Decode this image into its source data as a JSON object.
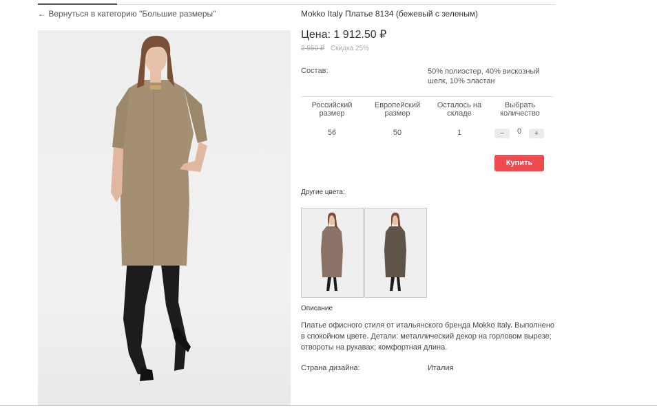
{
  "nav": {
    "back_link": "Вернуться в категорию \"Большие размеры\""
  },
  "product": {
    "title": "Mokko Italy Платье 8134 (бежевый с зеленым)",
    "price": "Цена: 1 912.50 ₽",
    "old_price": "2 550 ₽",
    "discount": "Скидка 25%",
    "composition_label": "Состав:",
    "composition_value": "50% полиэстер, 40% вискозный шелк, 10% эластан"
  },
  "size_table": {
    "headers": [
      "Российский размер",
      "Европейский размер",
      "Осталось на складе",
      "Выбрать количество"
    ],
    "rows": [
      {
        "ru_size": "56",
        "eu_size": "50",
        "in_stock": "1",
        "quantity": "0"
      }
    ],
    "minus_label": "−",
    "plus_label": "+"
  },
  "buy_button": {
    "label": "Купить"
  },
  "other_colors": {
    "label": "Другие цвета:",
    "items": [
      {
        "color": "#8a7366"
      },
      {
        "color": "#5f5449"
      }
    ]
  },
  "description": {
    "label": "Описание",
    "text": "Платье офисного стиля от итальянского бренда Mokko Italy. Выполнено в спокойном цвете. Детали: металлический декор на горловом вырезе; отвороты на рукавах; комфортная длина."
  },
  "country": {
    "label": "Страна дизайна:",
    "value": "Италия"
  },
  "colors": {
    "accent": "#ef4a4f",
    "dress_main": "#a48f73",
    "tights": "#1c1c1c"
  }
}
